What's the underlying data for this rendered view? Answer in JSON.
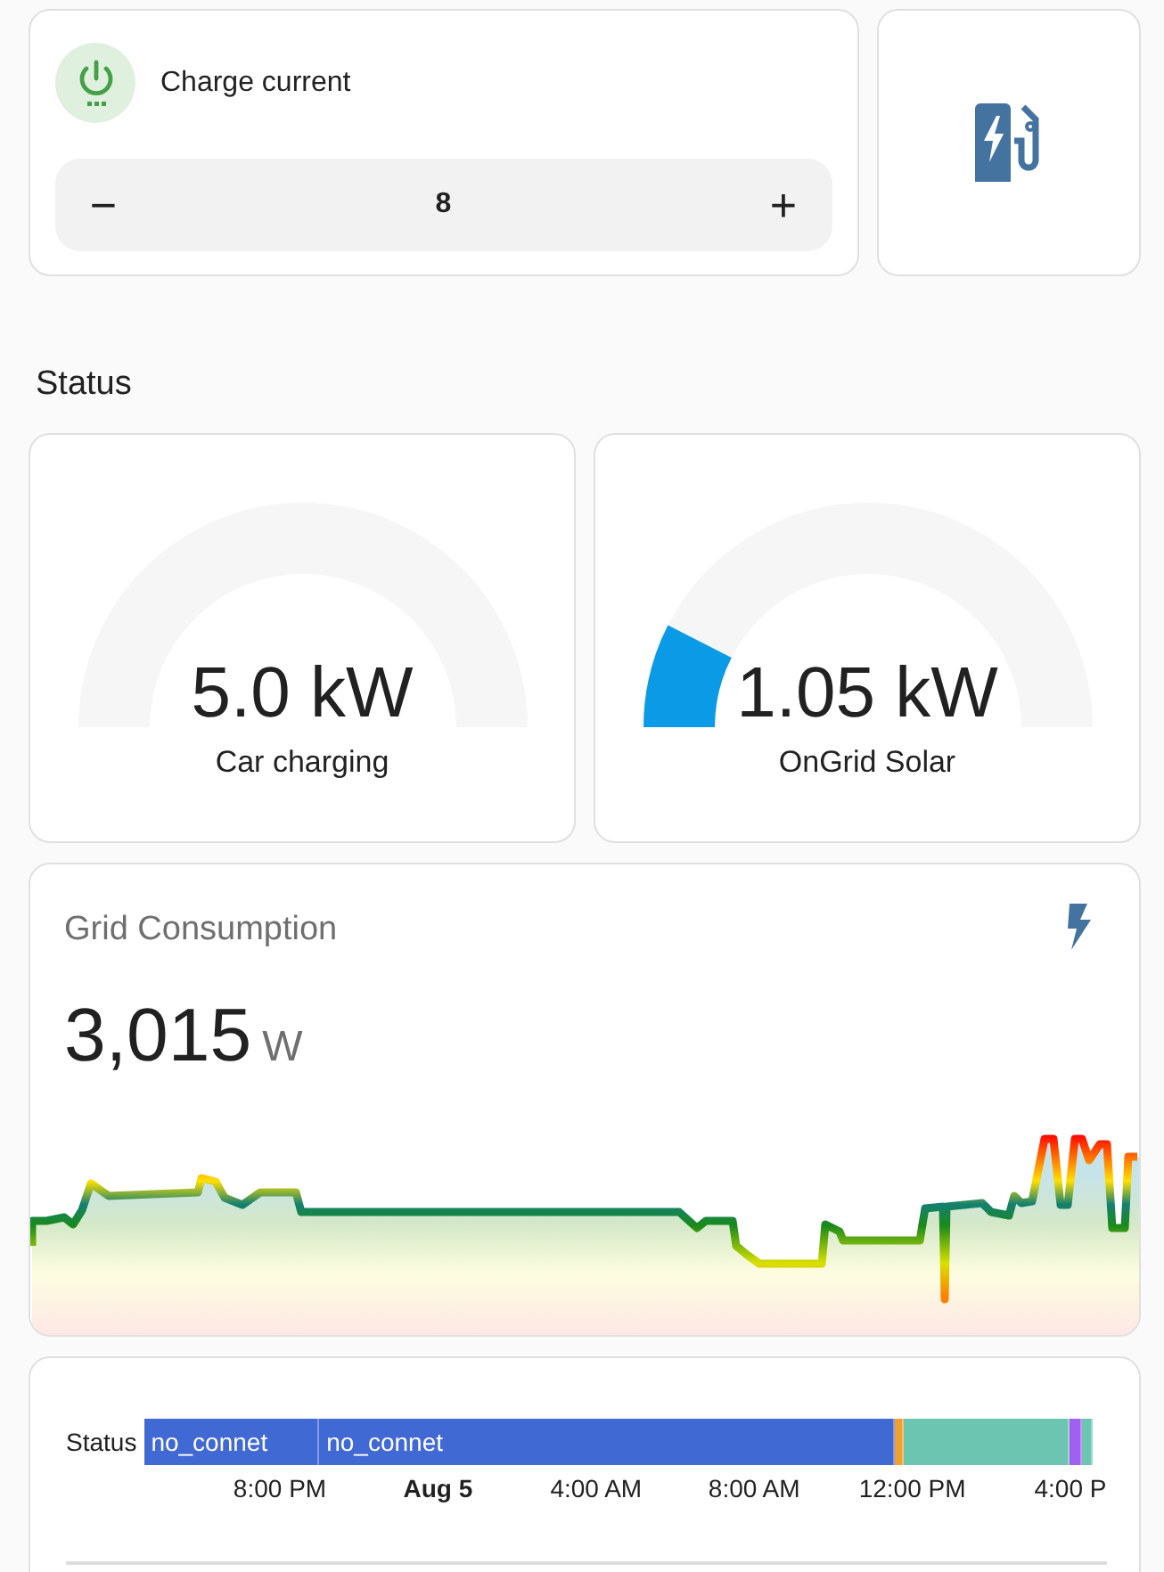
{
  "charge_card": {
    "title": "Charge current",
    "on": true,
    "stepper": {
      "decrement": "−",
      "value": "8",
      "increment": "+"
    }
  },
  "section_title": "Status",
  "gauges": [
    {
      "value": "5.0 kW",
      "label": "Car charging"
    },
    {
      "value": "1.05 kW",
      "label": "OnGrid Solar"
    }
  ],
  "grid_card": {
    "title": "Grid Consumption",
    "value": "3,015",
    "unit": "W"
  },
  "timeline": {
    "row_label": "Status",
    "segments": [
      {
        "label": "no_connet",
        "color": "#4169d4"
      },
      {
        "label": "no_connet",
        "color": "#4169d4"
      },
      {
        "color": "#f0a030"
      },
      {
        "color": "#6cc5b0"
      },
      {
        "color": "#a060f0"
      },
      {
        "color": "#6cc5b0"
      }
    ],
    "ticks": [
      {
        "label": "8:00 PM",
        "bold": false
      },
      {
        "label": "Aug 5",
        "bold": true
      },
      {
        "label": "4:00 AM",
        "bold": false
      },
      {
        "label": "8:00 AM",
        "bold": false
      },
      {
        "label": "12:00 PM",
        "bold": false
      },
      {
        "label": "4:00 P",
        "bold": false
      }
    ]
  }
}
